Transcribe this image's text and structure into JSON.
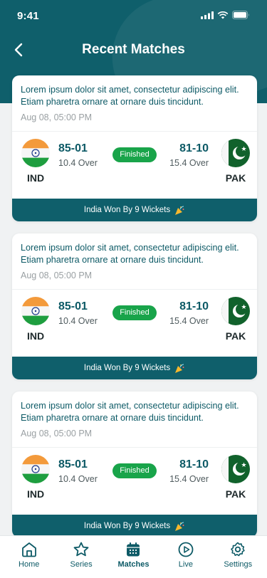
{
  "status": {
    "time": "9:41"
  },
  "header": {
    "title": "Recent Matches"
  },
  "matches": [
    {
      "description": "Lorem ipsum dolor sit amet, consectetur adipiscing elit. Etiam pharetra ornare at ornare duis tincidunt.",
      "date": "Aug 08, 05:00 PM",
      "team1": {
        "name": "IND",
        "score": "85-01",
        "overs": "10.4 Over"
      },
      "team2": {
        "name": "PAK",
        "score": "81-10",
        "overs": "15.4 Over"
      },
      "status": "Finished",
      "result": "India Won By 9 Wickets"
    },
    {
      "description": "Lorem ipsum dolor sit amet, consectetur adipiscing elit. Etiam pharetra ornare at ornare duis tincidunt.",
      "date": "Aug 08, 05:00 PM",
      "team1": {
        "name": "IND",
        "score": "85-01",
        "overs": "10.4 Over"
      },
      "team2": {
        "name": "PAK",
        "score": "81-10",
        "overs": "15.4 Over"
      },
      "status": "Finished",
      "result": "India Won By 9 Wickets"
    },
    {
      "description": "Lorem ipsum dolor sit amet, consectetur adipiscing elit. Etiam pharetra ornare at ornare duis tincidunt.",
      "date": "Aug 08, 05:00 PM",
      "team1": {
        "name": "IND",
        "score": "85-01",
        "overs": "10.4 Over"
      },
      "team2": {
        "name": "PAK",
        "score": "81-10",
        "overs": "15.4 Over"
      },
      "status": "Finished",
      "result": "India Won By 9 Wickets"
    }
  ],
  "tabs": [
    {
      "label": "Home",
      "icon": "home-icon"
    },
    {
      "label": "Series",
      "icon": "star-icon"
    },
    {
      "label": "Matches",
      "icon": "calendar-icon",
      "active": true
    },
    {
      "label": "Live",
      "icon": "play-icon"
    },
    {
      "label": "Settings",
      "icon": "gear-icon"
    }
  ],
  "colors": {
    "primary": "#0f5f6b",
    "badge": "#19a44a",
    "background": "#f0f2f3"
  }
}
